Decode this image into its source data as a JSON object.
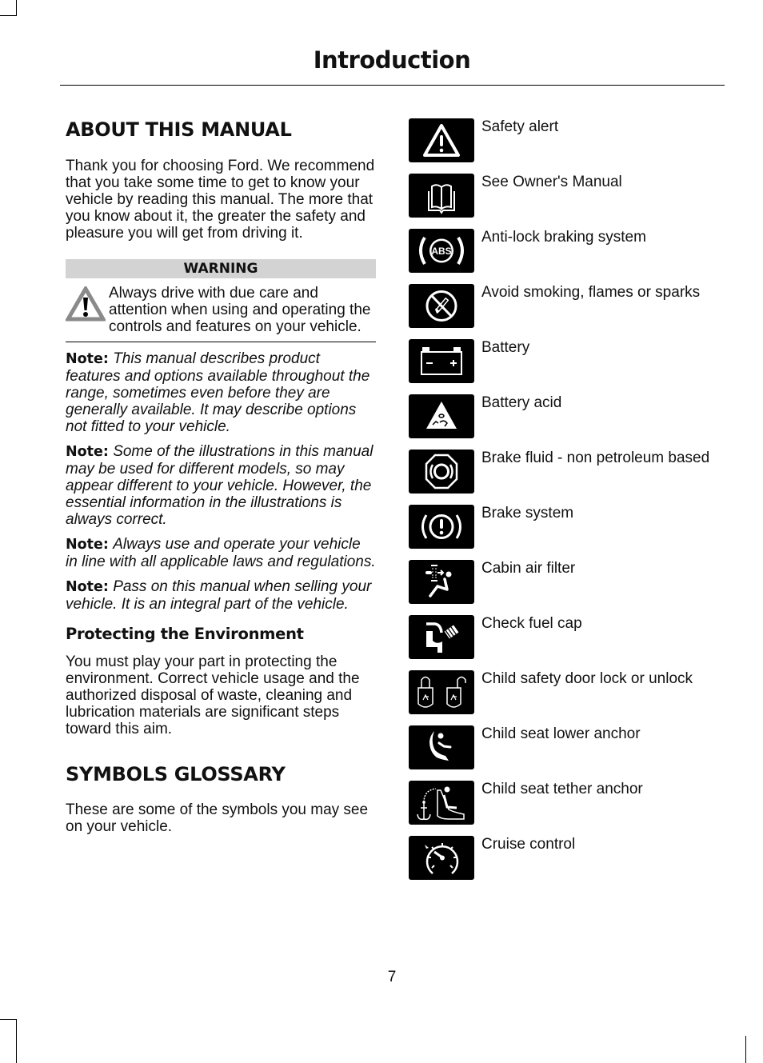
{
  "header": {
    "title": "Introduction"
  },
  "about": {
    "heading": "ABOUT THIS MANUAL",
    "intro": "Thank you for choosing Ford. We recommend that you take some time to get to know your vehicle by reading this manual. The more that you know about it, the greater the safety and pleasure you will get from driving it.",
    "warning": {
      "label": "WARNING",
      "icon": "warning-triangle-icon",
      "text": "Always drive with due care and attention when using and operating the controls and features on your vehicle."
    },
    "notes": [
      {
        "label": "Note:",
        "text": "This manual describes product features and options available throughout the range, sometimes even before they are generally available. It may describe options not fitted to your vehicle."
      },
      {
        "label": "Note:",
        "text": "Some of the illustrations in this manual may be used for different models, so may appear different to your vehicle. However, the essential information in the illustrations is always correct."
      },
      {
        "label": "Note:",
        "text": "Always use and operate your vehicle in line with all applicable laws and regulations."
      },
      {
        "label": "Note:",
        "text": "Pass on this manual when selling your vehicle. It is an integral part of the vehicle."
      }
    ]
  },
  "environment": {
    "heading": "Protecting the Environment",
    "text": "You must play your part in protecting the environment. Correct vehicle usage and the authorized disposal of waste, cleaning and lubrication materials are significant steps toward this aim."
  },
  "glossary": {
    "heading": "SYMBOLS GLOSSARY",
    "intro": "These are some of the symbols you may see on your vehicle.",
    "symbols": [
      {
        "icon": "safety-alert-icon",
        "label": "Safety alert"
      },
      {
        "icon": "owners-manual-icon",
        "label": "See Owner's Manual"
      },
      {
        "icon": "abs-icon",
        "label": "Anti-lock braking system",
        "icon_text": "ABS"
      },
      {
        "icon": "no-smoking-icon",
        "label": "Avoid smoking, flames or sparks"
      },
      {
        "icon": "battery-icon",
        "label": "Battery"
      },
      {
        "icon": "battery-acid-icon",
        "label": "Battery acid"
      },
      {
        "icon": "brake-fluid-icon",
        "label": "Brake fluid - non petroleum based"
      },
      {
        "icon": "brake-system-icon",
        "label": "Brake system"
      },
      {
        "icon": "cabin-air-filter-icon",
        "label": "Cabin air filter"
      },
      {
        "icon": "fuel-cap-icon",
        "label": "Check fuel cap"
      },
      {
        "icon": "child-lock-icon",
        "label": "Child safety door lock or unlock"
      },
      {
        "icon": "child-seat-lower-anchor-icon",
        "label": "Child seat lower anchor"
      },
      {
        "icon": "child-seat-tether-anchor-icon",
        "label": "Child seat tether anchor"
      },
      {
        "icon": "cruise-control-icon",
        "label": "Cruise control"
      }
    ]
  },
  "footer": {
    "page_number": "7"
  }
}
